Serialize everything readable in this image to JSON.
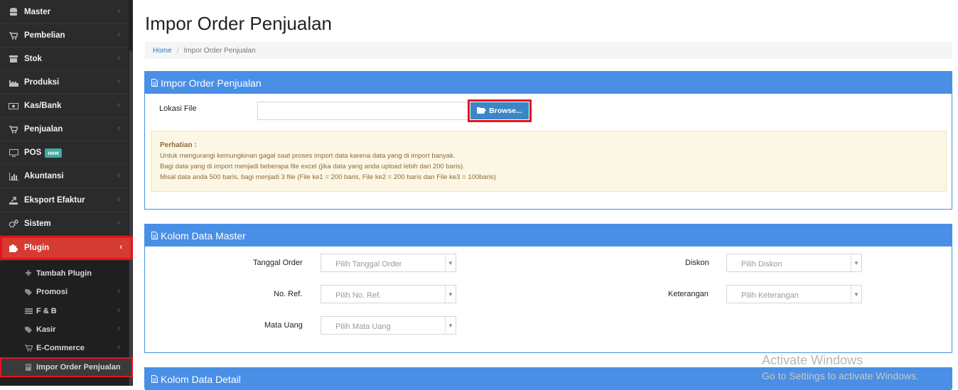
{
  "sidebar": {
    "items": [
      {
        "label": "Master",
        "icon": "database-icon"
      },
      {
        "label": "Pembelian",
        "icon": "cart-icon"
      },
      {
        "label": "Stok",
        "icon": "box-icon"
      },
      {
        "label": "Produksi",
        "icon": "factory-icon"
      },
      {
        "label": "Kas/Bank",
        "icon": "money-icon"
      },
      {
        "label": "Penjualan",
        "icon": "cart-icon"
      },
      {
        "label": "POS",
        "icon": "monitor-icon",
        "badge": "new"
      },
      {
        "label": "Akuntansi",
        "icon": "bar-chart-icon"
      },
      {
        "label": "Eksport Efaktur",
        "icon": "export-icon"
      },
      {
        "label": "Sistem",
        "icon": "gears-icon"
      },
      {
        "label": "Plugin",
        "icon": "puzzle-icon"
      }
    ],
    "subitems": [
      {
        "label": "Tambah Plugin",
        "icon": "plus-icon"
      },
      {
        "label": "Promosi",
        "icon": "tags-icon"
      },
      {
        "label": "F & B",
        "icon": "food-icon"
      },
      {
        "label": "Kasir",
        "icon": "tags-icon"
      },
      {
        "label": "E-Commerce",
        "icon": "cart-icon"
      },
      {
        "label": "Impor Order Penjualan",
        "icon": "book-icon"
      }
    ]
  },
  "header": {
    "title": "Impor Order Penjualan",
    "breadcrumb_home": "Home",
    "breadcrumb_sep": "/",
    "breadcrumb_current": "Impor Order Penjualan"
  },
  "import_panel": {
    "title": "Impor Order Penjualan",
    "file_label": "Lokasi File",
    "browse_label": "Browse...",
    "notice_title": "Perhatian :",
    "notice_lines": [
      "Untuk mengurangi kemungkinan gagal saat proses import data karena data yang di import banyak.",
      "Bagi data yang di import menjadi beberapa file excel (jika data yang anda upload lebih dari 200 baris).",
      "Misal data anda 500 baris, bagi menjadi 3 file (File ke1 = 200 baris, File ke2 = 200 baris dan File ke3 = 100baris)"
    ]
  },
  "master_panel": {
    "title": "Kolom Data Master",
    "fields": {
      "tanggal_order": {
        "label": "Tanggal Order",
        "placeholder": "Pilih Tanggal Order"
      },
      "no_ref": {
        "label": "No. Ref.",
        "placeholder": "Pilih No. Ref."
      },
      "mata_uang": {
        "label": "Mata Uang",
        "placeholder": "Pilih Mata Uang"
      },
      "diskon": {
        "label": "Diskon",
        "placeholder": "Pilih Diskon"
      },
      "keterangan": {
        "label": "Keterangan",
        "placeholder": "Pilih Keterangan"
      }
    }
  },
  "detail_panel": {
    "title": "Kolom Data Detail"
  },
  "watermark": {
    "line1": "Activate Windows",
    "line2": "Go to Settings to activate Windows."
  },
  "colors": {
    "sidebar_bg": "#2b2b2b",
    "accent_blue": "#4a8fe6",
    "active_red": "#d63b33",
    "highlight_red": "#e4141e"
  }
}
